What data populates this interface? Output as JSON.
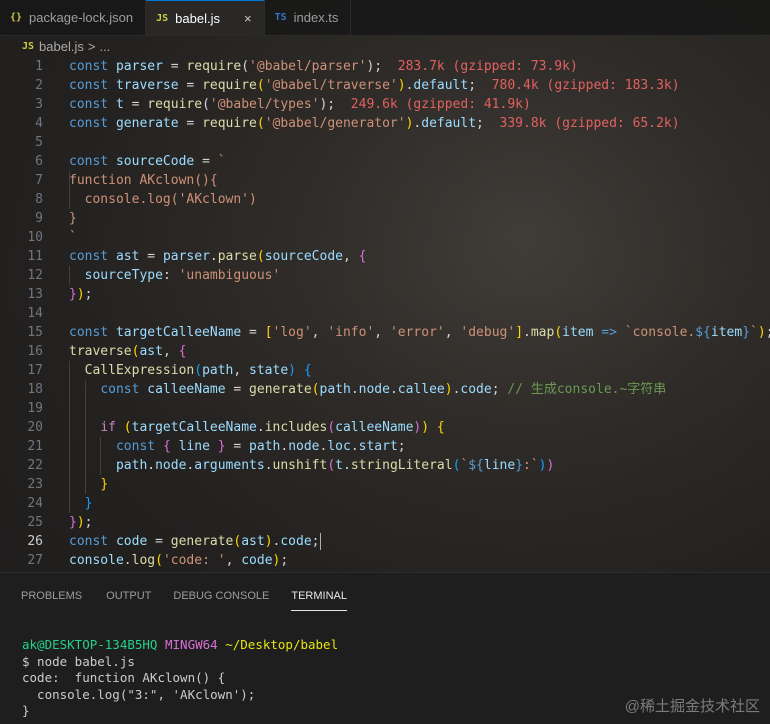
{
  "tabs": [
    {
      "icon": "{}",
      "label": "package-lock.json",
      "active": false
    },
    {
      "icon": "JS",
      "label": "babel.js",
      "active": true,
      "close": "×"
    },
    {
      "icon": "TS",
      "label": "index.ts",
      "active": false
    }
  ],
  "breadcrumb": {
    "icon": "JS",
    "file": "babel.js",
    "sep": ">",
    "more": "..."
  },
  "editor": {
    "active_line": 26,
    "lines": [
      {
        "n": "1",
        "tokens": [
          [
            "kw",
            "const "
          ],
          [
            "var",
            "parser"
          ],
          [
            "op",
            " = "
          ],
          [
            "fn",
            "require"
          ],
          [
            "op",
            "("
          ],
          [
            "str",
            "'@babel/parser'"
          ],
          [
            "op",
            ");"
          ],
          [
            "op",
            "  "
          ],
          [
            "size",
            "283.7k (gzipped: 73.9k)"
          ]
        ]
      },
      {
        "n": "2",
        "tokens": [
          [
            "kw",
            "const "
          ],
          [
            "var",
            "traverse"
          ],
          [
            "op",
            " = "
          ],
          [
            "fn",
            "require"
          ],
          [
            "b1",
            "("
          ],
          [
            "str",
            "'@babel/traverse'"
          ],
          [
            "b1",
            ")"
          ],
          [
            "op",
            "."
          ],
          [
            "var",
            "default"
          ],
          [
            "op",
            ";  "
          ],
          [
            "size",
            "780.4k (gzipped: 183.3k)"
          ]
        ]
      },
      {
        "n": "3",
        "tokens": [
          [
            "kw",
            "const "
          ],
          [
            "var",
            "t"
          ],
          [
            "op",
            " = "
          ],
          [
            "fn",
            "require"
          ],
          [
            "op",
            "("
          ],
          [
            "str",
            "'@babel/types'"
          ],
          [
            "op",
            ");  "
          ],
          [
            "size",
            "249.6k (gzipped: 41.9k)"
          ]
        ]
      },
      {
        "n": "4",
        "tokens": [
          [
            "kw",
            "const "
          ],
          [
            "var",
            "generate"
          ],
          [
            "op",
            " = "
          ],
          [
            "fn",
            "require"
          ],
          [
            "b1",
            "("
          ],
          [
            "str",
            "'@babel/generator'"
          ],
          [
            "b1",
            ")"
          ],
          [
            "op",
            "."
          ],
          [
            "var",
            "default"
          ],
          [
            "op",
            ";  "
          ],
          [
            "size",
            "339.8k (gzipped: 65.2k)"
          ]
        ]
      },
      {
        "n": "5",
        "tokens": []
      },
      {
        "n": "6",
        "tokens": [
          [
            "kw",
            "const "
          ],
          [
            "var",
            "sourceCode"
          ],
          [
            "op",
            " = "
          ],
          [
            "str",
            "`"
          ]
        ]
      },
      {
        "n": "7",
        "tokens": [
          [
            "str",
            "function AKclown(){"
          ]
        ]
      },
      {
        "n": "8",
        "tokens": [
          [
            "str",
            "  console.log('AKclown')"
          ]
        ]
      },
      {
        "n": "9",
        "tokens": [
          [
            "str",
            "}"
          ]
        ]
      },
      {
        "n": "10",
        "tokens": [
          [
            "str",
            "`"
          ]
        ]
      },
      {
        "n": "11",
        "tokens": [
          [
            "kw",
            "const "
          ],
          [
            "var",
            "ast"
          ],
          [
            "op",
            " = "
          ],
          [
            "var",
            "parser"
          ],
          [
            "op",
            "."
          ],
          [
            "fn",
            "parse"
          ],
          [
            "b1",
            "("
          ],
          [
            "var",
            "sourceCode"
          ],
          [
            "op",
            ", "
          ],
          [
            "b2",
            "{"
          ]
        ]
      },
      {
        "n": "12",
        "tokens": [
          [
            "op",
            "  "
          ],
          [
            "var",
            "sourceType"
          ],
          [
            "op",
            ": "
          ],
          [
            "str",
            "'unambiguous'"
          ]
        ]
      },
      {
        "n": "13",
        "tokens": [
          [
            "b2",
            "}"
          ],
          [
            "b1",
            ")"
          ],
          [
            "op",
            ";"
          ]
        ]
      },
      {
        "n": "14",
        "tokens": []
      },
      {
        "n": "15",
        "tokens": [
          [
            "kw",
            "const "
          ],
          [
            "var",
            "targetCalleeName"
          ],
          [
            "op",
            " = "
          ],
          [
            "b1",
            "["
          ],
          [
            "str",
            "'log'"
          ],
          [
            "op",
            ", "
          ],
          [
            "str",
            "'info'"
          ],
          [
            "op",
            ", "
          ],
          [
            "str",
            "'error'"
          ],
          [
            "op",
            ", "
          ],
          [
            "str",
            "'debug'"
          ],
          [
            "b1",
            "]"
          ],
          [
            "op",
            "."
          ],
          [
            "fn",
            "map"
          ],
          [
            "b1",
            "("
          ],
          [
            "var",
            "item"
          ],
          [
            "op",
            " "
          ],
          [
            "kw",
            "=>"
          ],
          [
            "op",
            " "
          ],
          [
            "str",
            "`console."
          ],
          [
            "tpl",
            "${"
          ],
          [
            "var",
            "item"
          ],
          [
            "tpl",
            "}"
          ],
          [
            "str",
            "`"
          ],
          [
            "b1",
            ")"
          ],
          [
            "op",
            ";"
          ]
        ]
      },
      {
        "n": "16",
        "tokens": [
          [
            "fn",
            "traverse"
          ],
          [
            "b1",
            "("
          ],
          [
            "var",
            "ast"
          ],
          [
            "op",
            ", "
          ],
          [
            "b2",
            "{"
          ]
        ]
      },
      {
        "n": "17",
        "tokens": [
          [
            "op",
            "  "
          ],
          [
            "fn",
            "CallExpression"
          ],
          [
            "b3",
            "("
          ],
          [
            "var",
            "path"
          ],
          [
            "op",
            ", "
          ],
          [
            "var",
            "state"
          ],
          [
            "b3",
            ")"
          ],
          [
            "op",
            " "
          ],
          [
            "b3",
            "{"
          ]
        ]
      },
      {
        "n": "18",
        "tokens": [
          [
            "op",
            "    "
          ],
          [
            "kw",
            "const "
          ],
          [
            "var",
            "calleeName"
          ],
          [
            "op",
            " = "
          ],
          [
            "fn",
            "generate"
          ],
          [
            "b1",
            "("
          ],
          [
            "var",
            "path"
          ],
          [
            "op",
            "."
          ],
          [
            "var",
            "node"
          ],
          [
            "op",
            "."
          ],
          [
            "var",
            "callee"
          ],
          [
            "b1",
            ")"
          ],
          [
            "op",
            "."
          ],
          [
            "var",
            "code"
          ],
          [
            "op",
            "; "
          ],
          [
            "cm",
            "// 生成console.~字符串"
          ]
        ]
      },
      {
        "n": "19",
        "tokens": []
      },
      {
        "n": "20",
        "tokens": [
          [
            "op",
            "    "
          ],
          [
            "ctl",
            "if "
          ],
          [
            "b1",
            "("
          ],
          [
            "var",
            "targetCalleeName"
          ],
          [
            "op",
            "."
          ],
          [
            "fn",
            "includes"
          ],
          [
            "b2",
            "("
          ],
          [
            "var",
            "calleeName"
          ],
          [
            "b2",
            ")"
          ],
          [
            "b1",
            ")"
          ],
          [
            "op",
            " "
          ],
          [
            "b1",
            "{"
          ]
        ]
      },
      {
        "n": "21",
        "tokens": [
          [
            "op",
            "      "
          ],
          [
            "kw",
            "const "
          ],
          [
            "b2",
            "{ "
          ],
          [
            "var",
            "line"
          ],
          [
            "b2",
            " }"
          ],
          [
            "op",
            " = "
          ],
          [
            "var",
            "path"
          ],
          [
            "op",
            "."
          ],
          [
            "var",
            "node"
          ],
          [
            "op",
            "."
          ],
          [
            "var",
            "loc"
          ],
          [
            "op",
            "."
          ],
          [
            "var",
            "start"
          ],
          [
            "op",
            ";"
          ]
        ]
      },
      {
        "n": "22",
        "tokens": [
          [
            "op",
            "      "
          ],
          [
            "var",
            "path"
          ],
          [
            "op",
            "."
          ],
          [
            "var",
            "node"
          ],
          [
            "op",
            "."
          ],
          [
            "var",
            "arguments"
          ],
          [
            "op",
            "."
          ],
          [
            "fn",
            "unshift"
          ],
          [
            "b2",
            "("
          ],
          [
            "var",
            "t"
          ],
          [
            "op",
            "."
          ],
          [
            "fn",
            "stringLiteral"
          ],
          [
            "b3",
            "("
          ],
          [
            "str",
            "`"
          ],
          [
            "tpl",
            "${"
          ],
          [
            "var",
            "line"
          ],
          [
            "tpl",
            "}"
          ],
          [
            "str",
            ":`"
          ],
          [
            "b3",
            ")"
          ],
          [
            "b2",
            ")"
          ]
        ]
      },
      {
        "n": "23",
        "tokens": [
          [
            "op",
            "    "
          ],
          [
            "b1",
            "}"
          ]
        ]
      },
      {
        "n": "24",
        "tokens": [
          [
            "op",
            "  "
          ],
          [
            "b3",
            "}"
          ]
        ]
      },
      {
        "n": "25",
        "tokens": [
          [
            "b2",
            "}"
          ],
          [
            "b1",
            ")"
          ],
          [
            "op",
            ";"
          ]
        ]
      },
      {
        "n": "26",
        "tokens": [
          [
            "kw",
            "const "
          ],
          [
            "var",
            "code"
          ],
          [
            "op",
            " = "
          ],
          [
            "fn",
            "generate"
          ],
          [
            "b1",
            "("
          ],
          [
            "var",
            "ast"
          ],
          [
            "b1",
            ")"
          ],
          [
            "op",
            "."
          ],
          [
            "var",
            "code"
          ],
          [
            "op",
            ";"
          ]
        ],
        "cursor": true
      },
      {
        "n": "27",
        "tokens": [
          [
            "var",
            "console"
          ],
          [
            "op",
            "."
          ],
          [
            "fn",
            "log"
          ],
          [
            "b1",
            "("
          ],
          [
            "str",
            "'code: '"
          ],
          [
            "op",
            ", "
          ],
          [
            "var",
            "code"
          ],
          [
            "b1",
            ")"
          ],
          [
            "op",
            ";"
          ]
        ]
      }
    ]
  },
  "panel": {
    "tabs": [
      {
        "label": "PROBLEMS",
        "active": false
      },
      {
        "label": "OUTPUT",
        "active": false
      },
      {
        "label": "DEBUG CONSOLE",
        "active": false
      },
      {
        "label": "TERMINAL",
        "active": true
      }
    ],
    "terminal": {
      "user": "ak@DESKTOP-134B5HQ",
      "host": "MINGW64",
      "path": "~/Desktop/babel",
      "lines": [
        "$ node babel.js",
        "code:  function AKclown() {",
        "  console.log(\"3:\", 'AKclown');",
        "}"
      ]
    }
  },
  "watermark": "@稀土掘金技术社区"
}
